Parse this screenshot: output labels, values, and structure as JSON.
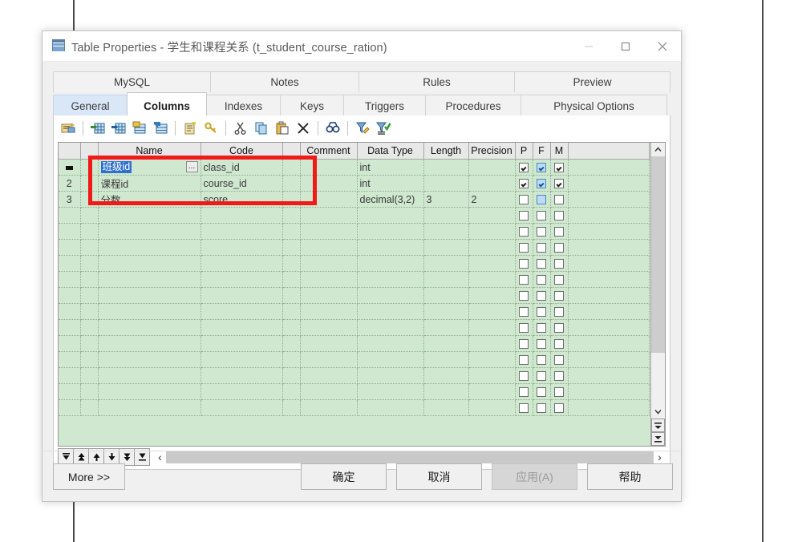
{
  "window": {
    "title": "Table Properties - 学生和课程关系 (t_student_course_ration)",
    "icon": "table-icon",
    "minimize": "−",
    "maximize": "□",
    "close": "✕"
  },
  "tabs": {
    "row1": [
      {
        "label": "MySQL",
        "state": "inactive"
      },
      {
        "label": "Notes",
        "state": "inactive"
      },
      {
        "label": "Rules",
        "state": "inactive"
      },
      {
        "label": "Preview",
        "state": "inactive"
      }
    ],
    "row2": [
      {
        "label": "General",
        "state": "highlighted"
      },
      {
        "label": "Columns",
        "state": "active"
      },
      {
        "label": "Indexes",
        "state": "inactive"
      },
      {
        "label": "Keys",
        "state": "inactive"
      },
      {
        "label": "Triggers",
        "state": "inactive"
      },
      {
        "label": "Procedures",
        "state": "inactive"
      },
      {
        "label": "Physical Options",
        "state": "inactive"
      }
    ]
  },
  "toolbar": {
    "items": [
      {
        "name": "properties-icon",
        "title": "Properties"
      },
      {
        "name": "insert-row-icon",
        "title": "Insert a Row"
      },
      {
        "name": "add-row-icon",
        "title": "Add a Row"
      },
      {
        "name": "edit-row-icon",
        "title": "Edit Row"
      },
      {
        "name": "duplicate-row-icon",
        "title": "Duplicate Row"
      },
      {
        "name": "notes-icon",
        "title": "Notes"
      },
      {
        "name": "key-icon",
        "title": "Primary Key"
      },
      {
        "name": "cut-icon",
        "title": "Cut"
      },
      {
        "name": "copy-icon",
        "title": "Copy"
      },
      {
        "name": "paste-icon",
        "title": "Paste"
      },
      {
        "name": "delete-icon",
        "title": "Delete"
      },
      {
        "name": "find-icon",
        "title": "Find"
      },
      {
        "name": "filter-edit-icon",
        "title": "Customize Columns and Filter"
      },
      {
        "name": "filter-apply-icon",
        "title": "Apply Filter"
      }
    ]
  },
  "grid": {
    "columns": [
      "",
      "",
      "Name",
      "Code",
      "",
      "Comment",
      "Data Type",
      "Length",
      "Precision",
      "P",
      "F",
      "M",
      ""
    ],
    "rows": [
      {
        "num": "",
        "current": true,
        "name": "班级id",
        "name_selected": true,
        "has_ellipsis": true,
        "ellipsis_label": "...",
        "code": "class_id",
        "comment": "",
        "data_type": "int",
        "length": "",
        "precision": "",
        "p": true,
        "f": true,
        "m": true
      },
      {
        "num": "2",
        "current": false,
        "name": "课程id",
        "name_selected": false,
        "has_ellipsis": false,
        "code": "course_id",
        "comment": "",
        "data_type": "int",
        "length": "",
        "precision": "",
        "p": true,
        "f": true,
        "m": true
      },
      {
        "num": "3",
        "current": false,
        "name": "分数",
        "name_selected": false,
        "has_ellipsis": false,
        "code": "score",
        "comment": "",
        "data_type": "decimal(3,2)",
        "length": "3",
        "precision": "2",
        "p": false,
        "f": false,
        "m": false
      }
    ],
    "empty_row_count": 13
  },
  "navbar": {
    "buttons": [
      {
        "name": "first-row-button",
        "glyph": "first"
      },
      {
        "name": "prev-page-button",
        "glyph": "upup"
      },
      {
        "name": "prev-row-button",
        "glyph": "up"
      },
      {
        "name": "next-row-button",
        "glyph": "down"
      },
      {
        "name": "next-page-button",
        "glyph": "downdown"
      },
      {
        "name": "last-row-button",
        "glyph": "last"
      }
    ],
    "scroll_left": "‹",
    "scroll_right": "›"
  },
  "footer": {
    "more": "More >>",
    "ok": "确定",
    "cancel": "取消",
    "apply": "应用(A)",
    "apply_disabled": true,
    "help": "帮助"
  },
  "annotation": {
    "type": "red-rectangle-highlight",
    "color": "#f01a19"
  }
}
